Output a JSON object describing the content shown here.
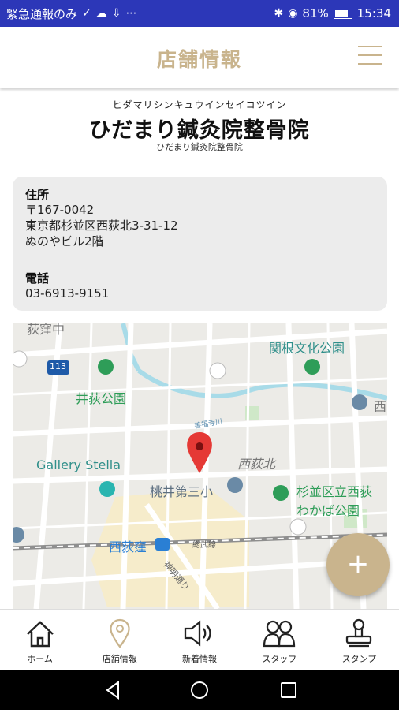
{
  "statusbar": {
    "left_text": "緊急通報のみ",
    "battery": "81%",
    "time": "15:34"
  },
  "header": {
    "title": "店舗情報"
  },
  "clinic": {
    "kana": "ヒダマリシンキュウインセイコツイン",
    "name": "ひだまり鍼灸院整骨院",
    "ruby": "ひだまり鍼灸院整骨院"
  },
  "info": {
    "address_label": "住所",
    "postal": "〒167-0042",
    "address_line1": "東京都杉並区西荻北3-31-12",
    "address_line2": "ぬのやビル2階",
    "phone_label": "電話",
    "phone": "03-6913-9151"
  },
  "map": {
    "labels": {
      "park1": "関根文化公園",
      "park2": "井荻公園",
      "gallery": "Gallery Stella",
      "area": "西荻北",
      "school": "桃井第三小",
      "park3a": "杉並区立西荻",
      "park3b": "わかば公園",
      "station": "西荻窪",
      "line": "総武線",
      "road": "神明通り",
      "route": "113",
      "river": "善福寺川",
      "top_edge": "荻窪中",
      "right_edge": "西"
    },
    "colors": {
      "pin": "#e53935",
      "park": "#2e9d58",
      "label_teal": "#2f8f8a",
      "road_blue": "#1e5aa8"
    }
  },
  "fab": {
    "symbol": "+"
  },
  "bottom_nav": {
    "home": "ホーム",
    "store": "店舗情報",
    "news": "新着情報",
    "staff": "スタッフ",
    "stamp": "スタンプ"
  },
  "theme": {
    "accent": "#c9b48d",
    "statusbar_bg": "#2c37b8"
  }
}
